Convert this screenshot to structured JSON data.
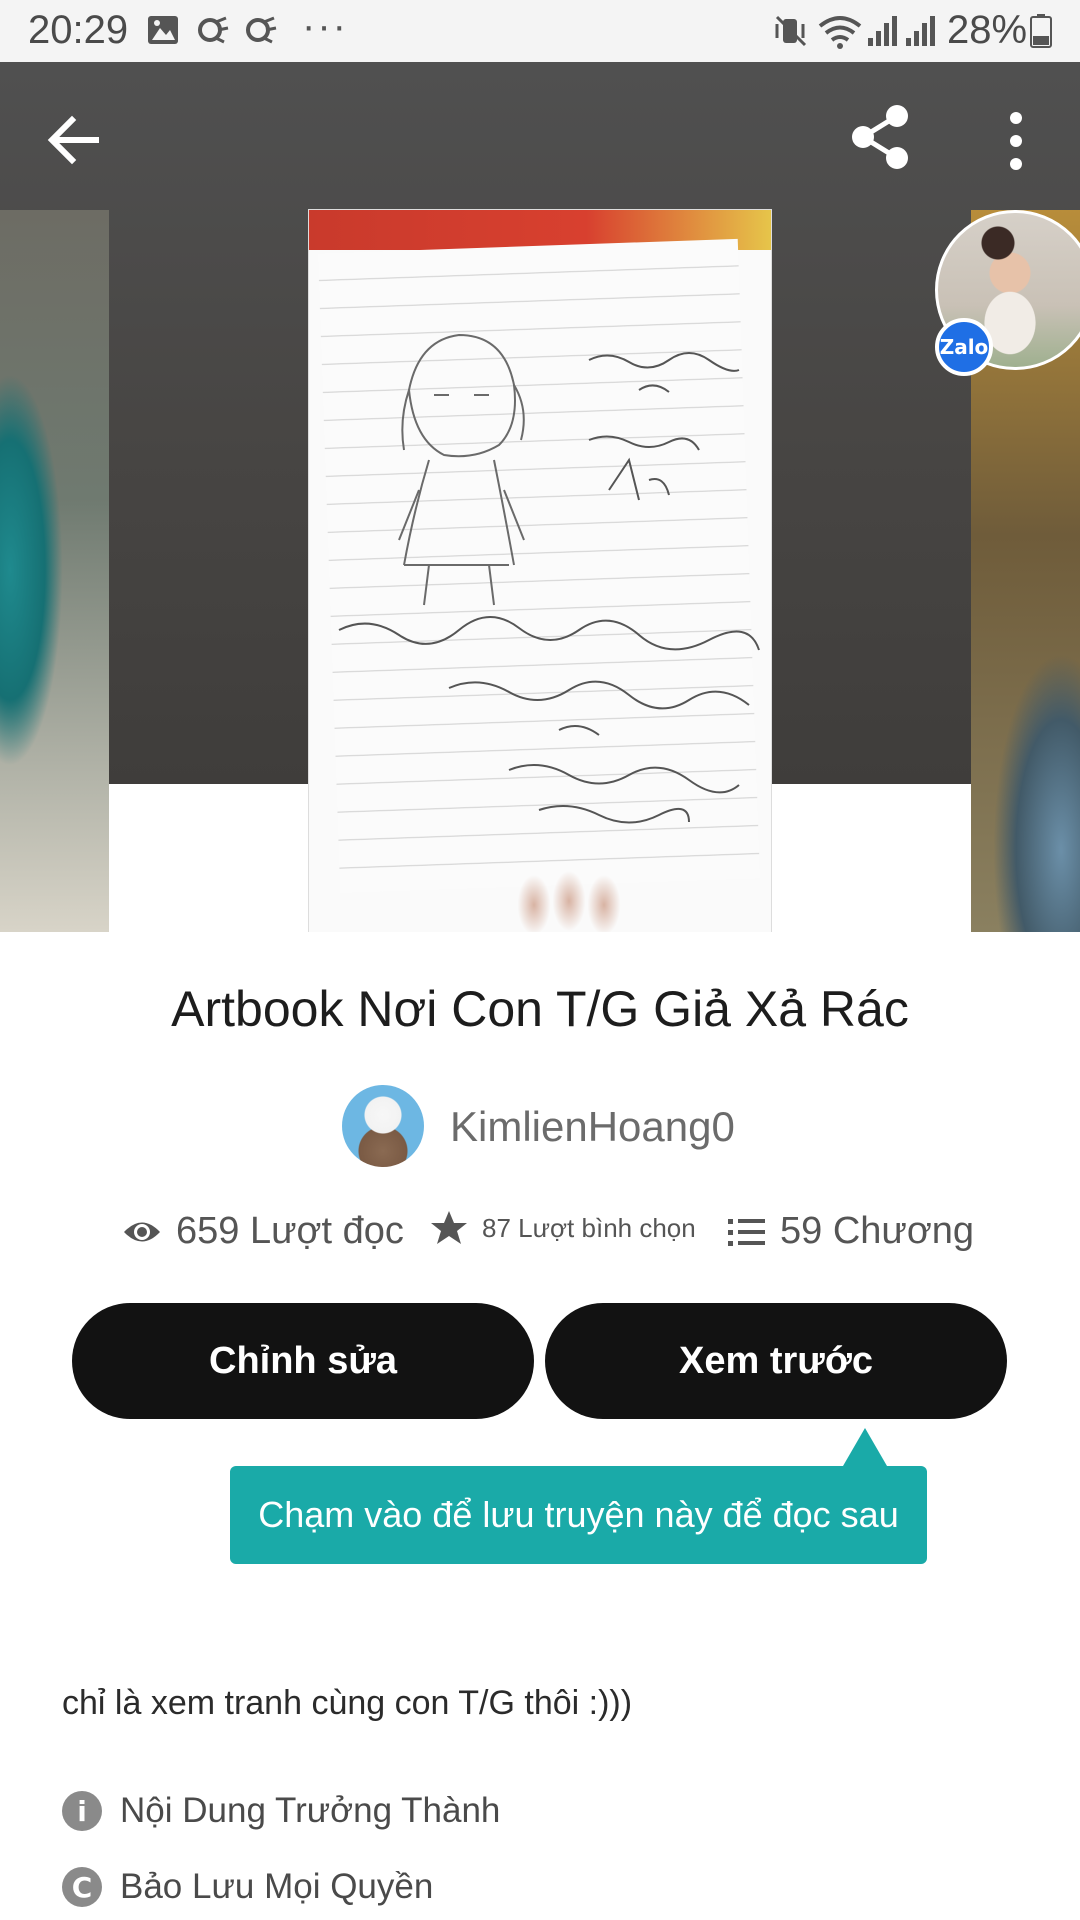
{
  "status_bar": {
    "time": "20:29",
    "battery": "28%",
    "more": "···"
  },
  "hero": {
    "back_icon": "arrow-left-icon",
    "share_icon": "share-icon",
    "more_icon": "more-vertical-icon",
    "background_color": "#474543",
    "zalo_label": "Zalo",
    "zalo_color": "#1f6fe5"
  },
  "story": {
    "title": "Artbook Nơi Con T/G Giả Xả Rác",
    "author": "KimlienHoang0",
    "stats": {
      "reads": "659 Lượt đọc",
      "votes": "87 Lượt bình chọn",
      "chapters": "59 Chương"
    },
    "buttons": {
      "edit": "Chỉnh sửa",
      "preview": "Xem trước"
    },
    "tooltip": "Chạm vào để lưu truyện này để đọc sau",
    "tooltip_color": "#1aaaa8",
    "description": "chỉ là xem tranh cùng con T/G thôi :)))",
    "meta": {
      "rating": "Nội Dung Trưởng Thành",
      "rating_icon": "info-icon",
      "copyright": "Bảo Lưu Mọi Quyền",
      "copyright_icon": "copyright-icon"
    }
  }
}
